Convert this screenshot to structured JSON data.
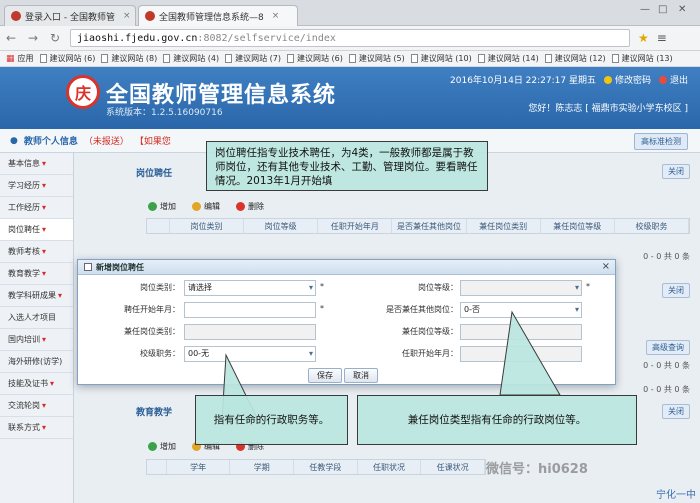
{
  "browser": {
    "tabs": [
      {
        "label": "登录入口 - 全国教师管",
        "close": "×"
      },
      {
        "label": "全国教师管理信息系统—8",
        "close": "×"
      }
    ],
    "url_host": "jiaoshi.fjedu.gov.cn",
    "url_path": ":8082/selfservice/index",
    "bookmarks_label": "应用",
    "bookmarks": [
      "建议网站 (6)",
      "建议网站 (8)",
      "建议网站 (4)",
      "建议网站 (7)",
      "建议网站 (6)",
      "建议网站 (5)",
      "建议网站 (10)",
      "建议网站 (14)",
      "建议网站 (12)",
      "建议网站 (13)"
    ]
  },
  "header": {
    "logo_char": "庆",
    "title": "全国教师管理信息系统",
    "version": "系统版本：1.2.5.16090716",
    "datetime": "2016年10月14日  22:27:17  星期五",
    "change_password": "修改密码",
    "exit": "退出",
    "user": "您好！陈志志 [ 福鼎市实验小学东校区 ]"
  },
  "pagebar": {
    "section": "教师个人信息",
    "status": "（未报送）",
    "hint": "【如果您"
  },
  "expand_button": "高标准检测",
  "sidebar": {
    "items": [
      "基本信息",
      "学习经历",
      "工作经历",
      "岗位聘任",
      "教师考核",
      "教育教学",
      "教学科研成果",
      "入选人才项目",
      "国内培训",
      "海外研修(访学)",
      "技能及证书",
      "交流轮岗",
      "联系方式"
    ]
  },
  "post_section": {
    "tab": "岗位聘任",
    "collapse": "关闭",
    "toolbar": {
      "add": "增加",
      "edit": "编辑",
      "delete": "删除"
    },
    "columns": [
      "",
      "岗位类别",
      "岗位等级",
      "任职开始年月",
      "是否兼任其他岗位",
      "兼任岗位类别",
      "兼任岗位等级",
      "校级职务"
    ],
    "count": "0 - 0  共 0 条"
  },
  "modal": {
    "title": "新增岗位聘任",
    "close": "×",
    "fields": {
      "post_category_label": "岗位类别：",
      "post_category_value": "请选择",
      "post_level_label": "岗位等级：",
      "start_date_label": "聘任开始年月：",
      "concurrent_label": "是否兼任其他岗位：",
      "concurrent_value": "0-否",
      "concurrent_category_label": "兼任岗位类别：",
      "concurrent_level_label": "兼任岗位等级：",
      "school_duty_label": "校级职务：",
      "school_duty_value": "00-无",
      "duty_start_label": "任职开始年月："
    },
    "save": "保存",
    "cancel": "取消"
  },
  "lower_section": {
    "tab": "教育教学",
    "collapse": "关闭",
    "toolbar": {
      "add": "增加",
      "edit": "编辑",
      "delete": "删除"
    },
    "columns": [
      "",
      "学年",
      "学期",
      "任教学段",
      "任职状况",
      "任课状况"
    ],
    "mid_button": "高级查询",
    "count1": "0 - 0  共 0 条",
    "count2": "0 - 0  共 0 条"
  },
  "callouts": {
    "top": "岗位聘任指专业技术聘任，为4类，一般教师都是属于教师岗位，还有其他专业技术、工勤、管理岗位。要看聘任情况。2013年1月开始填",
    "left": "指有任命的行政职务等。",
    "right": "兼任岗位类型指有任命的行政岗位等。"
  },
  "watermark": "微信号：hi0628",
  "corner_text": "宁化一中"
}
